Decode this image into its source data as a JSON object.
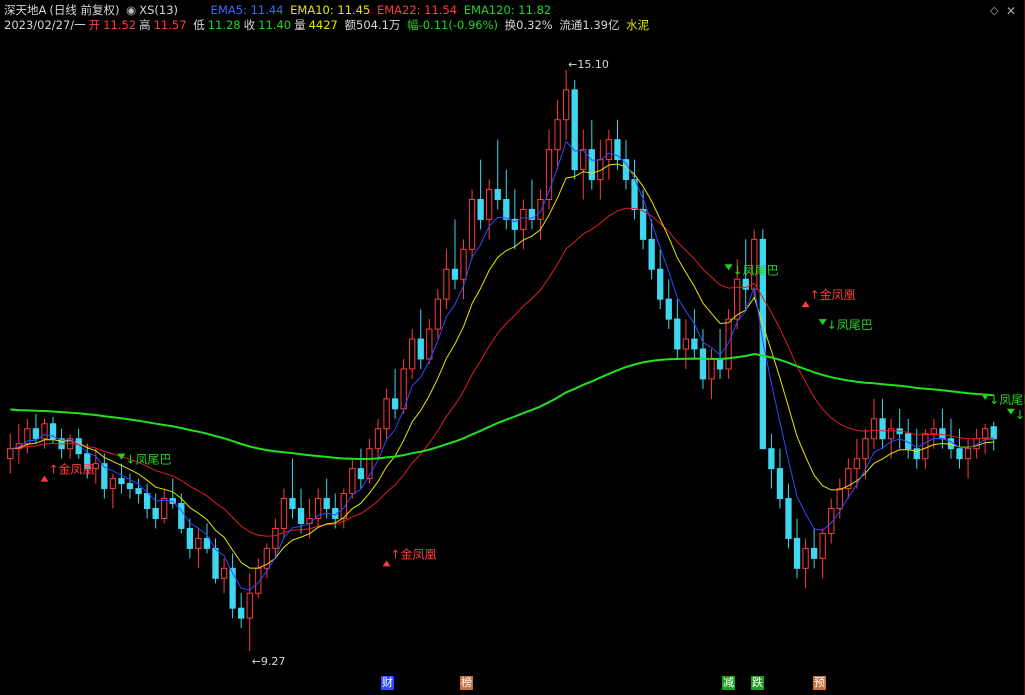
{
  "header": {
    "stock_name": "深天地A",
    "period": "(日线 前复权)",
    "indicator_name": "XS(13)",
    "ema5": "EMA5: 11.44",
    "ema10": "EMA10: 11.45",
    "ema22": "EMA22: 11.54",
    "ema120": "EMA120: 11.82",
    "date": "2023/02/27/一",
    "open_label": "开",
    "open": "11.52",
    "high_label": "高",
    "high": "11.57",
    "low_label": "低",
    "low": "11.28",
    "close_label": "收",
    "close": "11.40",
    "volume_label": "量",
    "volume": "4427",
    "amount": "额504.1万",
    "change": "幅-0.11(-0.96%)",
    "turnover": "换0.32%",
    "float_cap": "流通1.39亿",
    "sector": "水泥"
  },
  "window_controls": {
    "collapse_icon": "diamond-icon",
    "close_icon": "close-icon"
  },
  "colors": {
    "up": "#ff3b3b",
    "down": "#3fd6f0",
    "ema5": "#2a4bff",
    "ema10": "#e6e600",
    "ema22": "#e02020",
    "ema120": "#22e022",
    "background": "#000000"
  },
  "badges": [
    {
      "label": "财",
      "color": "#2a4bff"
    },
    {
      "label": "榜",
      "color": "#c87040"
    },
    {
      "label": "减",
      "color": "#1f9f1f"
    },
    {
      "label": "跌",
      "color": "#1f9f1f"
    },
    {
      "label": "预",
      "color": "#c87040"
    }
  ],
  "chart_data": {
    "type": "candlestick",
    "series_names": [
      "EMA5",
      "EMA10",
      "EMA22",
      "EMA120"
    ],
    "price_range": [
      9.1,
      15.4
    ],
    "max_label": "15.10",
    "min_label": "9.27",
    "candles": [
      [
        11.2,
        11.45,
        11.05,
        11.3
      ],
      [
        11.3,
        11.55,
        11.15,
        11.35
      ],
      [
        11.35,
        11.6,
        11.25,
        11.5
      ],
      [
        11.5,
        11.65,
        11.35,
        11.4
      ],
      [
        11.4,
        11.6,
        11.3,
        11.55
      ],
      [
        11.55,
        11.62,
        11.35,
        11.4
      ],
      [
        11.4,
        11.5,
        11.2,
        11.3
      ],
      [
        11.3,
        11.45,
        11.2,
        11.4
      ],
      [
        11.4,
        11.5,
        11.2,
        11.25
      ],
      [
        11.25,
        11.35,
        11.0,
        11.1
      ],
      [
        11.1,
        11.3,
        10.95,
        11.15
      ],
      [
        11.15,
        11.25,
        10.8,
        10.9
      ],
      [
        10.9,
        11.05,
        10.7,
        11.0
      ],
      [
        11.0,
        11.15,
        10.85,
        10.95
      ],
      [
        10.95,
        11.05,
        10.8,
        10.9
      ],
      [
        10.9,
        11.0,
        10.75,
        10.85
      ],
      [
        10.85,
        10.95,
        10.6,
        10.7
      ],
      [
        10.7,
        10.85,
        10.5,
        10.6
      ],
      [
        10.6,
        10.9,
        10.55,
        10.8
      ],
      [
        10.8,
        11.0,
        10.7,
        10.75
      ],
      [
        10.75,
        10.85,
        10.45,
        10.5
      ],
      [
        10.5,
        10.6,
        10.2,
        10.3
      ],
      [
        10.3,
        10.5,
        10.1,
        10.4
      ],
      [
        10.4,
        10.55,
        10.25,
        10.3
      ],
      [
        10.3,
        10.4,
        9.95,
        10.0
      ],
      [
        10.0,
        10.2,
        9.85,
        10.1
      ],
      [
        10.1,
        10.25,
        9.6,
        9.7
      ],
      [
        9.7,
        9.85,
        9.5,
        9.6
      ],
      [
        9.6,
        10.05,
        9.27,
        9.85
      ],
      [
        9.85,
        10.2,
        9.8,
        10.1
      ],
      [
        10.1,
        10.35,
        10.0,
        10.3
      ],
      [
        10.3,
        10.6,
        10.2,
        10.5
      ],
      [
        10.5,
        10.9,
        10.4,
        10.8
      ],
      [
        10.8,
        11.2,
        10.6,
        10.7
      ],
      [
        10.7,
        10.9,
        10.45,
        10.55
      ],
      [
        10.55,
        10.8,
        10.4,
        10.6
      ],
      [
        10.6,
        10.9,
        10.5,
        10.8
      ],
      [
        10.8,
        11.0,
        10.6,
        10.7
      ],
      [
        10.7,
        10.85,
        10.5,
        10.6
      ],
      [
        10.6,
        10.9,
        10.5,
        10.85
      ],
      [
        10.85,
        11.2,
        10.8,
        11.1
      ],
      [
        11.1,
        11.3,
        10.9,
        11.0
      ],
      [
        11.0,
        11.4,
        10.95,
        11.3
      ],
      [
        11.3,
        11.6,
        11.2,
        11.5
      ],
      [
        11.5,
        11.9,
        11.4,
        11.8
      ],
      [
        11.8,
        12.1,
        11.6,
        11.7
      ],
      [
        11.7,
        12.2,
        11.65,
        12.1
      ],
      [
        12.1,
        12.5,
        12.0,
        12.4
      ],
      [
        12.4,
        12.7,
        12.1,
        12.2
      ],
      [
        12.2,
        12.6,
        12.15,
        12.5
      ],
      [
        12.5,
        12.9,
        12.4,
        12.8
      ],
      [
        12.8,
        13.3,
        12.7,
        13.1
      ],
      [
        13.1,
        13.6,
        12.9,
        13.0
      ],
      [
        13.0,
        13.4,
        12.8,
        13.3
      ],
      [
        13.3,
        13.9,
        13.2,
        13.8
      ],
      [
        13.8,
        14.2,
        13.5,
        13.6
      ],
      [
        13.6,
        14.0,
        13.4,
        13.9
      ],
      [
        13.9,
        14.4,
        13.7,
        13.8
      ],
      [
        13.8,
        14.1,
        13.5,
        13.6
      ],
      [
        13.6,
        13.9,
        13.3,
        13.5
      ],
      [
        13.5,
        13.8,
        13.3,
        13.7
      ],
      [
        13.7,
        14.0,
        13.5,
        13.6
      ],
      [
        13.6,
        13.9,
        13.4,
        13.8
      ],
      [
        13.8,
        14.5,
        13.7,
        14.3
      ],
      [
        14.3,
        14.8,
        14.1,
        14.6
      ],
      [
        14.6,
        15.1,
        14.4,
        14.9
      ],
      [
        14.9,
        15.0,
        14.0,
        14.1
      ],
      [
        14.1,
        14.5,
        13.8,
        14.3
      ],
      [
        14.3,
        14.6,
        13.9,
        14.0
      ],
      [
        14.0,
        14.4,
        13.8,
        14.2
      ],
      [
        14.2,
        14.5,
        14.0,
        14.4
      ],
      [
        14.4,
        14.6,
        14.1,
        14.2
      ],
      [
        14.2,
        14.4,
        13.9,
        14.0
      ],
      [
        14.0,
        14.2,
        13.6,
        13.7
      ],
      [
        13.7,
        13.9,
        13.3,
        13.4
      ],
      [
        13.4,
        13.6,
        13.0,
        13.1
      ],
      [
        13.1,
        13.3,
        12.7,
        12.8
      ],
      [
        12.8,
        13.0,
        12.5,
        12.6
      ],
      [
        12.6,
        12.8,
        12.2,
        12.3
      ],
      [
        12.3,
        12.6,
        12.1,
        12.4
      ],
      [
        12.4,
        12.7,
        12.2,
        12.3
      ],
      [
        12.3,
        12.5,
        11.9,
        12.0
      ],
      [
        12.0,
        12.3,
        11.8,
        12.2
      ],
      [
        12.2,
        12.5,
        12.0,
        12.1
      ],
      [
        12.1,
        12.7,
        12.0,
        12.6
      ],
      [
        12.6,
        13.2,
        12.5,
        13.0
      ],
      [
        13.0,
        13.4,
        12.7,
        12.9
      ],
      [
        12.9,
        13.5,
        12.8,
        13.4
      ],
      [
        13.4,
        13.5,
        11.3,
        11.3
      ],
      [
        11.3,
        11.45,
        10.9,
        11.1
      ],
      [
        11.1,
        11.3,
        10.7,
        10.8
      ],
      [
        10.8,
        10.95,
        10.3,
        10.4
      ],
      [
        10.4,
        10.6,
        10.0,
        10.1
      ],
      [
        10.1,
        10.4,
        9.9,
        10.3
      ],
      [
        10.3,
        10.5,
        10.1,
        10.2
      ],
      [
        10.2,
        10.5,
        10.0,
        10.45
      ],
      [
        10.45,
        10.8,
        10.35,
        10.7
      ],
      [
        10.7,
        11.0,
        10.6,
        10.9
      ],
      [
        10.9,
        11.2,
        10.8,
        11.1
      ],
      [
        11.1,
        11.4,
        10.9,
        11.2
      ],
      [
        11.2,
        11.5,
        11.0,
        11.4
      ],
      [
        11.4,
        11.8,
        11.3,
        11.6
      ],
      [
        11.6,
        11.8,
        11.3,
        11.4
      ],
      [
        11.4,
        11.6,
        11.2,
        11.5
      ],
      [
        11.5,
        11.7,
        11.3,
        11.45
      ],
      [
        11.45,
        11.6,
        11.2,
        11.3
      ],
      [
        11.3,
        11.5,
        11.1,
        11.2
      ],
      [
        11.2,
        11.5,
        11.1,
        11.45
      ],
      [
        11.45,
        11.6,
        11.3,
        11.5
      ],
      [
        11.5,
        11.7,
        11.3,
        11.4
      ],
      [
        11.4,
        11.6,
        11.2,
        11.3
      ],
      [
        11.3,
        11.5,
        11.1,
        11.2
      ],
      [
        11.2,
        11.4,
        11.0,
        11.3
      ],
      [
        11.3,
        11.5,
        11.2,
        11.4
      ],
      [
        11.4,
        11.55,
        11.25,
        11.5
      ],
      [
        11.52,
        11.57,
        11.28,
        11.4
      ]
    ],
    "signals": [
      {
        "text": "↑金凤凰",
        "color": "#ff3b3b",
        "bar": 4,
        "price": 11.05
      },
      {
        "text": "↓凤尾巴",
        "color": "#21d421",
        "bar": 13,
        "price": 11.15
      },
      {
        "text": "↑金凤凰",
        "color": "#ff3b3b",
        "bar": 44,
        "price": 10.2
      },
      {
        "text": "↓凤尾巴",
        "color": "#21d421",
        "bar": 84,
        "price": 13.05
      },
      {
        "text": "↑金凤凰",
        "color": "#ff3b3b",
        "bar": 93,
        "price": 12.8
      },
      {
        "text": "↓凤尾巴",
        "color": "#21d421",
        "bar": 95,
        "price": 12.5
      },
      {
        "text": "↓凤尾巴",
        "color": "#21d421",
        "bar": 114,
        "price": 11.75
      },
      {
        "text": "↓凤尾巴",
        "color": "#21d421",
        "bar": 117,
        "price": 11.6
      }
    ]
  }
}
